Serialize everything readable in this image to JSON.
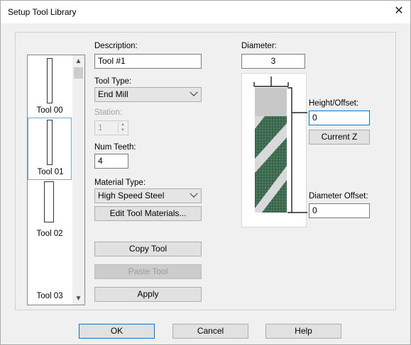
{
  "window": {
    "title": "Setup Tool Library",
    "close_glyph": "✕"
  },
  "tool_list": {
    "items": [
      {
        "label": "Tool 00"
      },
      {
        "label": "Tool 01"
      },
      {
        "label": "Tool 02"
      },
      {
        "label": "Tool 03"
      }
    ],
    "selected_index": 1
  },
  "form": {
    "description_label": "Description:",
    "description_value": "Tool #1",
    "tool_type_label": "Tool Type:",
    "tool_type_value": "End Mill",
    "station_label": "Station:",
    "station_value": "1",
    "num_teeth_label": "Num Teeth:",
    "num_teeth_value": "4",
    "material_type_label": "Material Type:",
    "material_type_value": "High Speed Steel",
    "edit_materials_label": "Edit Tool Materials...",
    "copy_tool_label": "Copy Tool",
    "paste_tool_label": "Paste Tool",
    "apply_label": "Apply"
  },
  "geometry_panel": {
    "diameter_label": "Diameter:",
    "diameter_value": "3",
    "height_offset_label": "Height/Offset:",
    "height_offset_value": "0",
    "current_z_label": "Current Z",
    "diameter_offset_label": "Diameter Offset:",
    "diameter_offset_value": "0"
  },
  "footer": {
    "ok_label": "OK",
    "cancel_label": "Cancel",
    "help_label": "Help"
  },
  "colors": {
    "accent": "#0078d7",
    "flute_green": "#3d6b4f",
    "shank_gray": "#c8c8c8"
  }
}
